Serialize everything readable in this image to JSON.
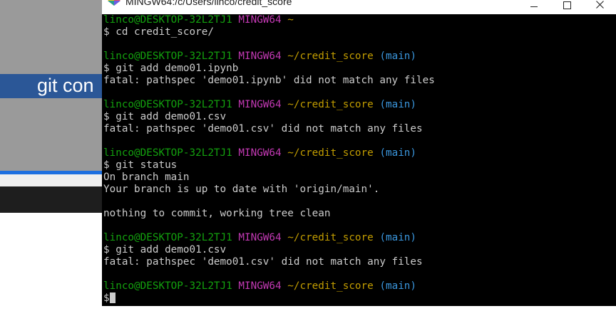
{
  "background_window": {
    "banner_text": "git con"
  },
  "terminal": {
    "title": "MINGW64:/c/Users/linco/credit_score",
    "lines": [
      {
        "kind": "prompt",
        "user": "linco@DESKTOP-32L2TJ1",
        "system": "MINGW64",
        "path": "~",
        "branch": ""
      },
      {
        "kind": "cmd",
        "text": "$ cd credit_score/"
      },
      {
        "kind": "blank"
      },
      {
        "kind": "prompt",
        "user": "linco@DESKTOP-32L2TJ1",
        "system": "MINGW64",
        "path": "~/credit_score",
        "branch": "(main)"
      },
      {
        "kind": "cmd",
        "text": "$ git add demo01.ipynb"
      },
      {
        "kind": "out",
        "text": "fatal: pathspec 'demo01.ipynb' did not match any files"
      },
      {
        "kind": "blank"
      },
      {
        "kind": "prompt",
        "user": "linco@DESKTOP-32L2TJ1",
        "system": "MINGW64",
        "path": "~/credit_score",
        "branch": "(main)"
      },
      {
        "kind": "cmd",
        "text": "$ git add demo01.csv"
      },
      {
        "kind": "out",
        "text": "fatal: pathspec 'demo01.csv' did not match any files"
      },
      {
        "kind": "blank"
      },
      {
        "kind": "prompt",
        "user": "linco@DESKTOP-32L2TJ1",
        "system": "MINGW64",
        "path": "~/credit_score",
        "branch": "(main)"
      },
      {
        "kind": "cmd",
        "text": "$ git status"
      },
      {
        "kind": "out",
        "text": "On branch main"
      },
      {
        "kind": "out",
        "text": "Your branch is up to date with 'origin/main'."
      },
      {
        "kind": "blank"
      },
      {
        "kind": "out",
        "text": "nothing to commit, working tree clean"
      },
      {
        "kind": "blank"
      },
      {
        "kind": "prompt",
        "user": "linco@DESKTOP-32L2TJ1",
        "system": "MINGW64",
        "path": "~/credit_score",
        "branch": "(main)"
      },
      {
        "kind": "cmd",
        "text": "$ git add demo01.csv"
      },
      {
        "kind": "out",
        "text": "fatal: pathspec 'demo01.csv' did not match any files"
      },
      {
        "kind": "blank"
      },
      {
        "kind": "prompt",
        "user": "linco@DESKTOP-32L2TJ1",
        "system": "MINGW64",
        "path": "~/credit_score",
        "branch": "(main)"
      },
      {
        "kind": "input",
        "text": "$"
      }
    ],
    "colors": {
      "background": "#000000",
      "user": "#13a10e",
      "system": "#c239b3",
      "path": "#c19c00",
      "branch": "#3a96dd",
      "text": "#cccccc"
    },
    "icons": {
      "app": "mingw-diamond-icon",
      "minimize": "minimize-icon",
      "maximize": "maximize-icon",
      "close": "close-icon"
    }
  }
}
